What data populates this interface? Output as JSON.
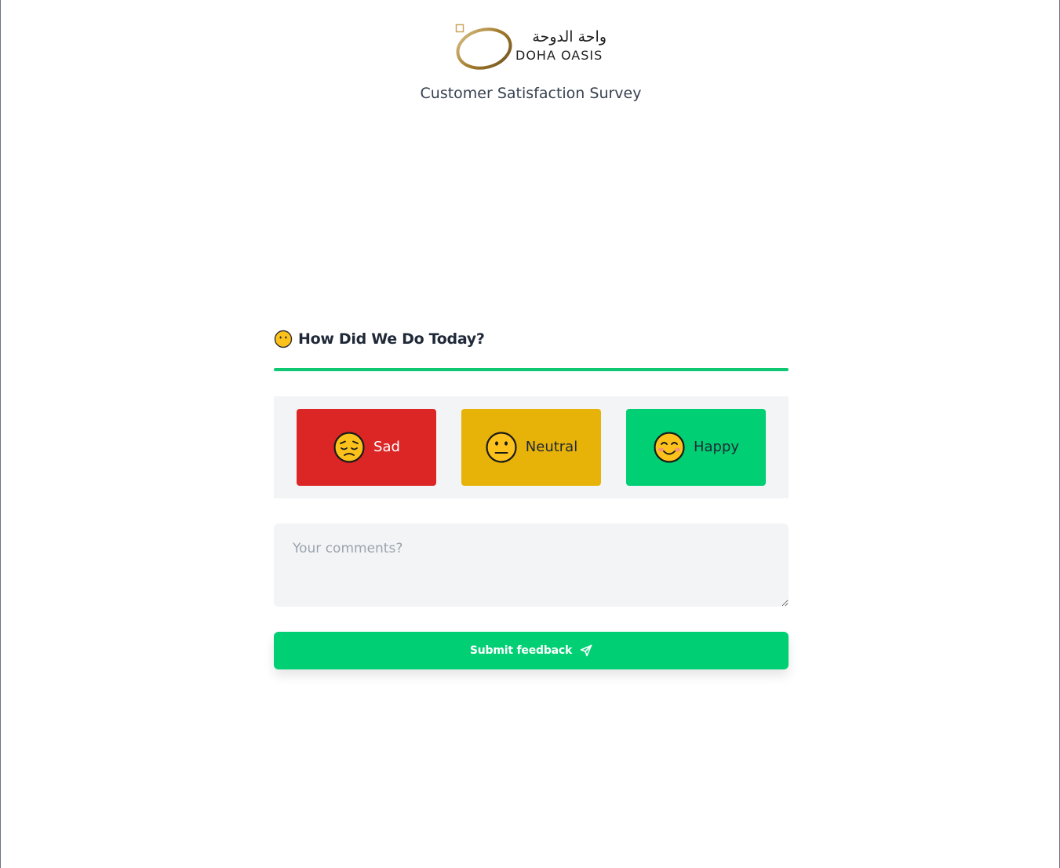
{
  "brand": {
    "name_ar": "واحة الدوحة",
    "name_en": "DOHA OASIS",
    "gold": "#b08d3e"
  },
  "page": {
    "subtitle": "Customer Satisfaction Survey"
  },
  "question": {
    "icon": "neutral-face-icon",
    "title": "How Did We Do Today?",
    "accent": "#10c872"
  },
  "ratings": [
    {
      "label": "Sad",
      "icon": "pensive-face-icon",
      "color": "#dc2626",
      "text_color": "#ffffff"
    },
    {
      "label": "Neutral",
      "icon": "neutral-face-icon",
      "color": "#e8b308",
      "text_color": "#1f2937"
    },
    {
      "label": "Happy",
      "icon": "smiling-face-icon",
      "color": "#00d073",
      "text_color": "#1f2937"
    }
  ],
  "comments": {
    "placeholder": "Your comments?",
    "value": ""
  },
  "submit": {
    "label": "Submit feedback",
    "icon": "send-icon",
    "color": "#00d073"
  }
}
